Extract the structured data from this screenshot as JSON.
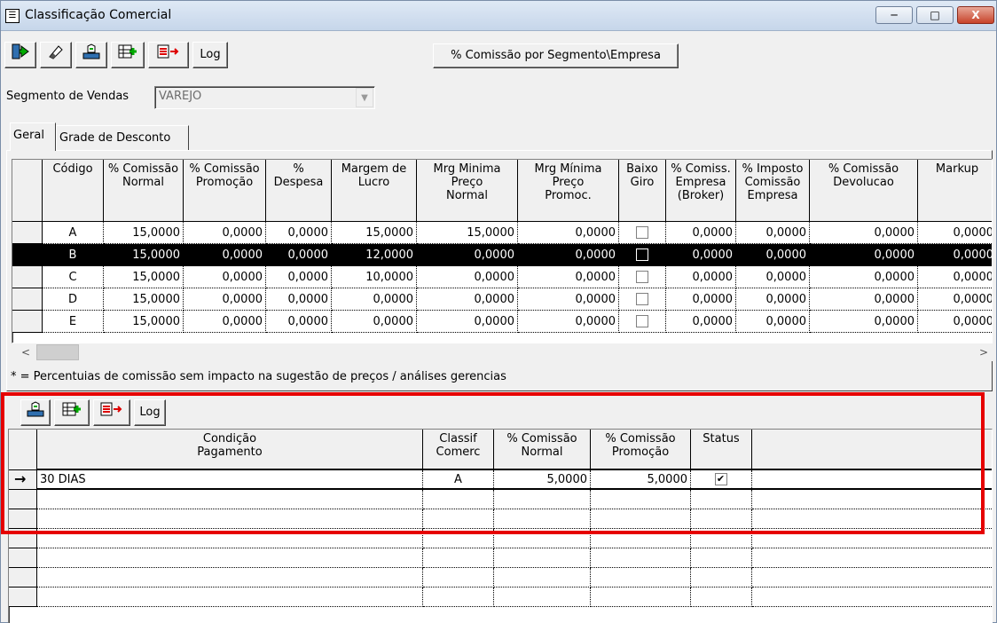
{
  "window": {
    "title": "Classificação Comercial",
    "app_icon": "form-icon",
    "controls": {
      "minimize": "─",
      "maximize": "□",
      "close": "X"
    }
  },
  "toolbar": {
    "icons": [
      "exit-door-icon",
      "eraser-icon",
      "save-tray-icon",
      "add-record-icon",
      "export-arrow-icon"
    ],
    "log_label": "Log",
    "comissao_button": "% Comissão por Segmento\\Empresa"
  },
  "segmento": {
    "label": "Segmento de Vendas",
    "value": "VAREJO"
  },
  "tabs": [
    {
      "label": "Geral"
    },
    {
      "label": "Grade de Desconto"
    }
  ],
  "main_grid": {
    "columns": [
      "Código",
      "% Comissão\nNormal",
      "% Comissão\nPromoção",
      "%\nDespesa",
      "Margem de\nLucro",
      "Mrg Minima\nPreço\nNormal",
      "Mrg Mínima\nPreço\nPromoc.",
      "Baixo\nGiro",
      "% Comiss.\nEmpresa\n(Broker)",
      "% Imposto\nComissão\nEmpresa",
      "% Comissão\nDevolucao",
      "Markup"
    ],
    "rows": [
      {
        "cells": [
          "A",
          "15,0000",
          "0,0000",
          "0,0000",
          "15,0000",
          "15,0000",
          "0,0000",
          "",
          "0,0000",
          "0,0000",
          "0,0000",
          "0,0000"
        ],
        "baixo_giro": false
      },
      {
        "cells": [
          "B",
          "15,0000",
          "0,0000",
          "0,0000",
          "12,0000",
          "0,0000",
          "0,0000",
          "",
          "0,0000",
          "0,0000",
          "0,0000",
          "0,0000"
        ],
        "baixo_giro": false,
        "selected": true
      },
      {
        "cells": [
          "C",
          "15,0000",
          "0,0000",
          "0,0000",
          "10,0000",
          "0,0000",
          "0,0000",
          "",
          "0,0000",
          "0,0000",
          "0,0000",
          "0,0000"
        ],
        "baixo_giro": false
      },
      {
        "cells": [
          "D",
          "15,0000",
          "0,0000",
          "0,0000",
          "0,0000",
          "0,0000",
          "0,0000",
          "",
          "0,0000",
          "0,0000",
          "0,0000",
          "0,0000"
        ],
        "baixo_giro": false
      },
      {
        "cells": [
          "E",
          "15,0000",
          "0,0000",
          "0,0000",
          "0,0000",
          "0,0000",
          "0,0000",
          "",
          "0,0000",
          "0,0000",
          "0,0000",
          "0,0000"
        ],
        "baixo_giro": false
      }
    ],
    "scroll_left": "<",
    "scroll_right": ">"
  },
  "note": "* = Percentuias de comissão sem impacto na sugestão de preços / análises gerencias",
  "sub_toolbar": {
    "icons": [
      "save-tray-icon",
      "add-record-icon",
      "export-arrow-icon"
    ],
    "log_label": "Log"
  },
  "sub_grid": {
    "columns": [
      "Condição\nPagamento",
      "Classif\nComerc",
      "% Comissão\nNormal",
      "% Comissão\nPromoção",
      "Status"
    ],
    "rows": [
      {
        "cells": [
          "30 DIAS",
          "A",
          "5,0000",
          "5,0000",
          ""
        ],
        "status": true,
        "current": true
      }
    ],
    "current_marker": "→",
    "empty_rows": 6
  },
  "highlight_color": "#e60000"
}
